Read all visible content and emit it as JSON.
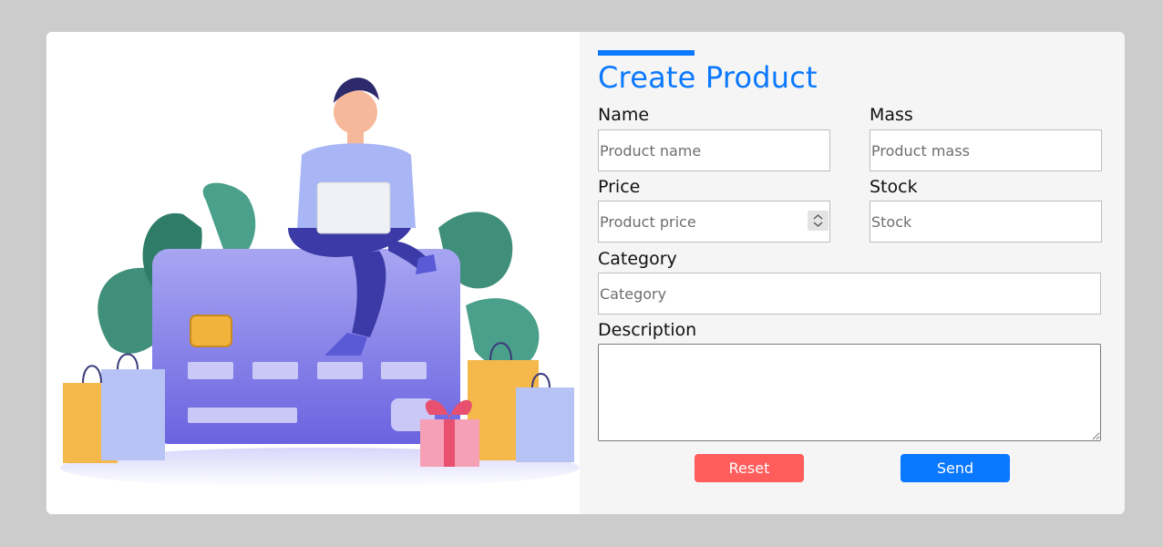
{
  "form": {
    "title": "Create Product",
    "name": {
      "label": "Name",
      "placeholder": "Product name"
    },
    "mass": {
      "label": "Mass",
      "placeholder": "Product mass"
    },
    "price": {
      "label": "Price",
      "placeholder": "Product price"
    },
    "stock": {
      "label": "Stock",
      "placeholder": "Stock"
    },
    "category": {
      "label": "Category",
      "placeholder": "Category"
    },
    "description": {
      "label": "Description",
      "placeholder": ""
    },
    "reset_label": "Reset",
    "send_label": "Send"
  },
  "colors": {
    "accent": "#0a78ff",
    "reset": "#ff5c5c",
    "page_background": "#cccccc",
    "form_background": "#f5f5f5"
  },
  "icons": {
    "illustration": "shopping-illustration",
    "spinner": "number-spinner-icon",
    "resize": "resize-grip-icon"
  }
}
